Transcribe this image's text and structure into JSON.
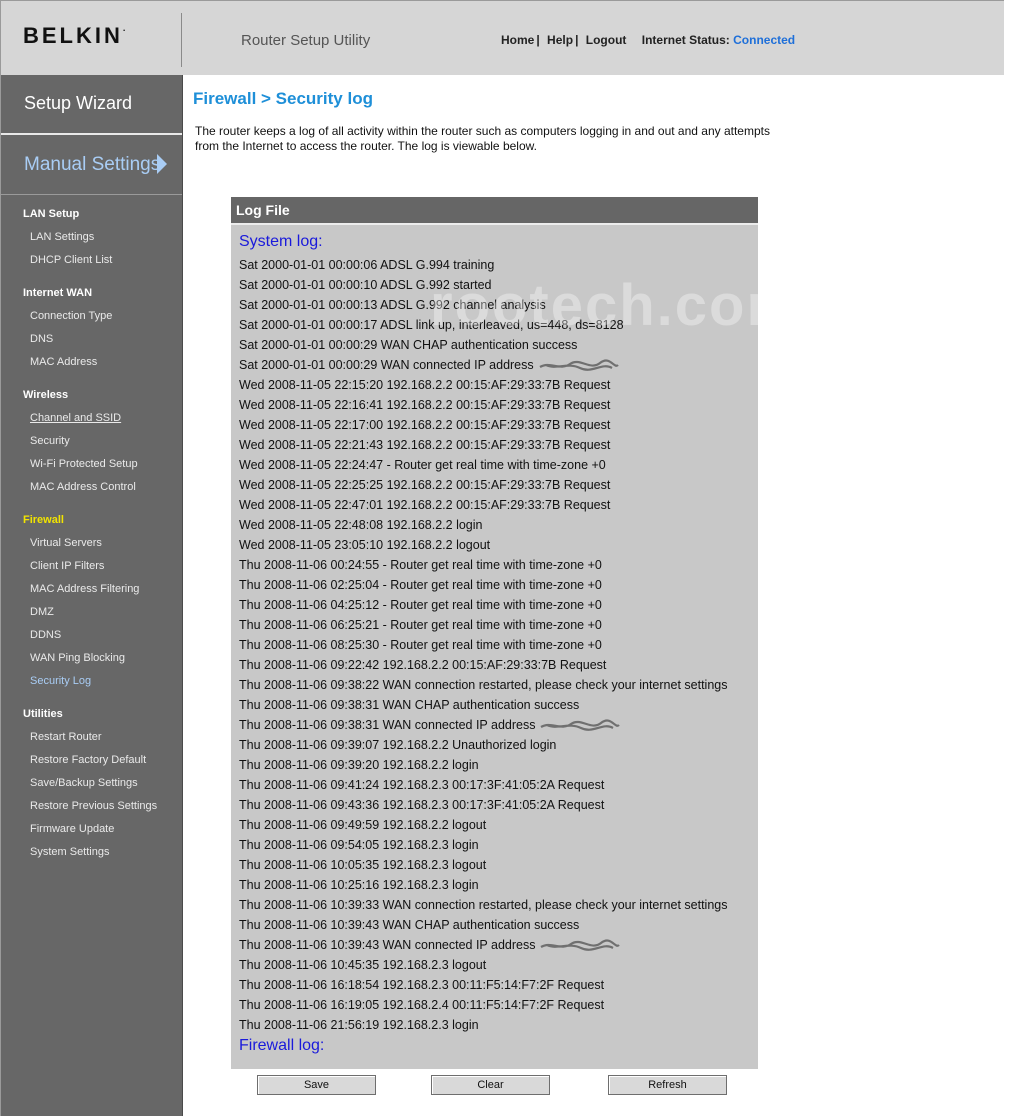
{
  "header": {
    "logo": "BELKIN",
    "logo_mark": ".",
    "utility_title": "Router Setup Utility",
    "links": [
      "Home",
      "Help",
      "Logout"
    ],
    "link_separator": "|",
    "status_label": "Internet Status:",
    "status_value": "Connected",
    "status_color": "#1e6fd9"
  },
  "sidebar": {
    "setup_wizard": "Setup Wizard",
    "manual_settings": "Manual Settings",
    "sections": [
      {
        "heading": "LAN Setup",
        "items": [
          "LAN Settings",
          "DHCP Client List"
        ]
      },
      {
        "heading": "Internet WAN",
        "items": [
          "Connection Type",
          "DNS",
          "MAC Address"
        ]
      },
      {
        "heading": "Wireless",
        "items": [
          "Channel and SSID",
          "Security",
          "Wi-Fi Protected Setup",
          "MAC Address Control"
        ]
      },
      {
        "heading": "Firewall",
        "items": [
          "Virtual Servers",
          "Client IP Filters",
          "MAC Address Filtering",
          "DMZ",
          "DDNS",
          "WAN Ping Blocking",
          "Security Log"
        ]
      },
      {
        "heading": "Utilities",
        "items": [
          "Restart Router",
          "Restore Factory Default",
          "Save/Backup Settings",
          "Restore Previous Settings",
          "Firmware Update",
          "System Settings"
        ]
      }
    ],
    "active_section": "Firewall",
    "current_item": "Security Log",
    "highlight_color": "#f2e400",
    "current_color": "#a9cdf5"
  },
  "main": {
    "title": "Firewall > Security log",
    "description": "The router keeps a log of all activity within the router such as computers logging in and out and any attempts from the Internet to access the router. The log is viewable below.",
    "watermark": "rootech.com",
    "log_panel": {
      "header": "Log File",
      "system_log_title": "System log:",
      "firewall_log_title": "Firewall log:",
      "lines": [
        "Sat 2000-01-01 00:00:06 ADSL G.994 training",
        "Sat 2000-01-01 00:00:10 ADSL G.992 started",
        "Sat 2000-01-01 00:00:13 ADSL G.992 channel analysis",
        "Sat 2000-01-01 00:00:17 ADSL link up, interleaved, us=448, ds=8128",
        "Sat 2000-01-01 00:00:29 WAN CHAP authentication success",
        "Sat 2000-01-01 00:00:29 WAN connected IP address",
        "Wed 2008-11-05 22:15:20 192.168.2.2 00:15:AF:29:33:7B Request",
        "Wed 2008-11-05 22:16:41 192.168.2.2 00:15:AF:29:33:7B Request",
        "Wed 2008-11-05 22:17:00 192.168.2.2 00:15:AF:29:33:7B Request",
        "Wed 2008-11-05 22:21:43 192.168.2.2 00:15:AF:29:33:7B Request",
        "Wed 2008-11-05 22:24:47 - Router get real time with time-zone +0",
        "Wed 2008-11-05 22:25:25 192.168.2.2 00:15:AF:29:33:7B Request",
        "Wed 2008-11-05 22:47:01 192.168.2.2 00:15:AF:29:33:7B Request",
        "Wed 2008-11-05 22:48:08 192.168.2.2 login",
        "Wed 2008-11-05 23:05:10 192.168.2.2 logout",
        "Thu 2008-11-06 00:24:55 - Router get real time with time-zone +0",
        "Thu 2008-11-06 02:25:04 - Router get real time with time-zone +0",
        "Thu 2008-11-06 04:25:12 - Router get real time with time-zone +0",
        "Thu 2008-11-06 06:25:21 - Router get real time with time-zone +0",
        "Thu 2008-11-06 08:25:30 - Router get real time with time-zone +0",
        "Thu 2008-11-06 09:22:42 192.168.2.2 00:15:AF:29:33:7B Request",
        "Thu 2008-11-06 09:38:22 WAN connection restarted, please check your internet settings",
        "Thu 2008-11-06 09:38:31 WAN CHAP authentication success",
        "Thu 2008-11-06 09:38:31 WAN connected IP address",
        "Thu 2008-11-06 09:39:07 192.168.2.2 Unauthorized login",
        "Thu 2008-11-06 09:39:20 192.168.2.2 login",
        "Thu 2008-11-06 09:41:24 192.168.2.3 00:17:3F:41:05:2A Request",
        "Thu 2008-11-06 09:43:36 192.168.2.3 00:17:3F:41:05:2A Request",
        "Thu 2008-11-06 09:49:59 192.168.2.2 logout",
        "Thu 2008-11-06 09:54:05 192.168.2.3 login",
        "Thu 2008-11-06 10:05:35 192.168.2.3 logout",
        "Thu 2008-11-06 10:25:16 192.168.2.3 login",
        "Thu 2008-11-06 10:39:33 WAN connection restarted, please check your internet settings",
        "Thu 2008-11-06 10:39:43 WAN CHAP authentication success",
        "Thu 2008-11-06 10:39:43 WAN connected IP address",
        "Thu 2008-11-06 10:45:35 192.168.2.3 logout",
        "Thu 2008-11-06 16:18:54 192.168.2.3 00:11:F5:14:F7:2F Request",
        "Thu 2008-11-06 16:19:05 192.168.2.4 00:11:F5:14:F7:2F Request",
        "Thu 2008-11-06 21:56:19 192.168.2.3 login"
      ]
    },
    "buttons": {
      "save": "Save",
      "clear": "Clear",
      "refresh": "Refresh"
    }
  }
}
